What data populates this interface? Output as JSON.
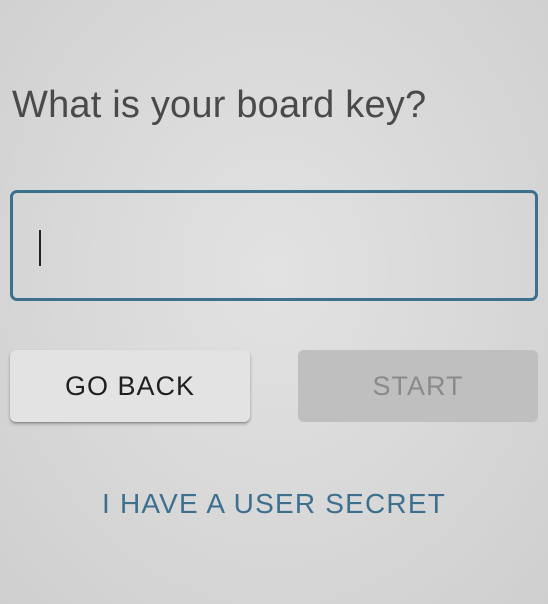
{
  "prompt": {
    "title": "What is your board key?"
  },
  "board_key_input": {
    "value": "",
    "placeholder": "",
    "focused": true,
    "border_color": "#3d6f8f"
  },
  "buttons": {
    "go_back_label": "GO BACK",
    "start_label": "START",
    "start_enabled": false
  },
  "links": {
    "user_secret_label": "I HAVE A USER SECRET",
    "link_color": "#3d6f8f"
  }
}
